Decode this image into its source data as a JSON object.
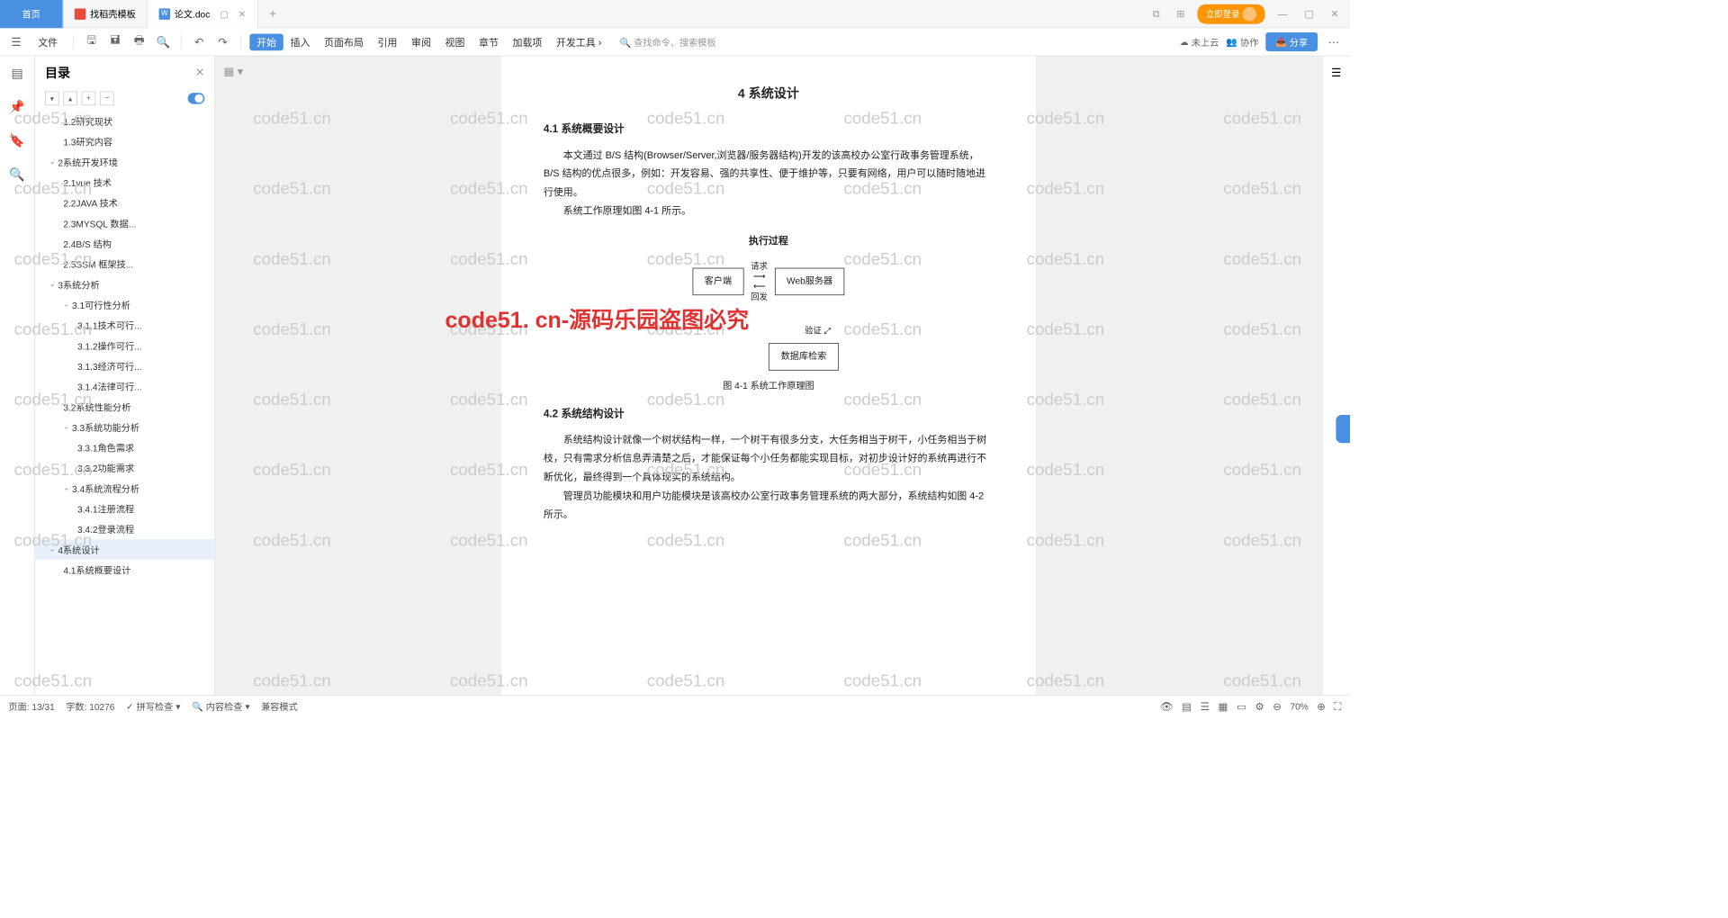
{
  "tabs": {
    "home": "首页",
    "template": "找稻壳模板",
    "doc": "论文.doc",
    "new": "+"
  },
  "titlebar": {
    "login": "立即登录"
  },
  "toolbar": {
    "file": "文件",
    "menu": [
      "开始",
      "插入",
      "页面布局",
      "引用",
      "审阅",
      "视图",
      "章节",
      "加载项",
      "开发工具"
    ],
    "search": "查找命令、搜索模板",
    "cloud": "未上云",
    "collab": "协作",
    "share": "分享"
  },
  "outline": {
    "title": "目录",
    "items": [
      {
        "l": 2,
        "t": "1.2研究现状"
      },
      {
        "l": 2,
        "t": "1.3研究内容"
      },
      {
        "l": 1,
        "t": "2系统开发环境",
        "c": true
      },
      {
        "l": 2,
        "t": "2.1vue 技术"
      },
      {
        "l": 2,
        "t": "2.2JAVA 技术"
      },
      {
        "l": 2,
        "t": "2.3MYSQL 数据..."
      },
      {
        "l": 2,
        "t": "2.4B/S 结构"
      },
      {
        "l": 2,
        "t": "2.5SSM 框架技..."
      },
      {
        "l": 1,
        "t": "3系统分析",
        "c": true
      },
      {
        "l": 2,
        "t": "3.1可行性分析",
        "c": true
      },
      {
        "l": 3,
        "t": "3.1.1技术可行..."
      },
      {
        "l": 3,
        "t": "3.1.2操作可行..."
      },
      {
        "l": 3,
        "t": "3.1.3经济可行..."
      },
      {
        "l": 3,
        "t": "3.1.4法律可行..."
      },
      {
        "l": 2,
        "t": "3.2系统性能分析"
      },
      {
        "l": 2,
        "t": "3.3系统功能分析",
        "c": true
      },
      {
        "l": 3,
        "t": "3.3.1角色需求"
      },
      {
        "l": 3,
        "t": "3.3.2功能需求"
      },
      {
        "l": 2,
        "t": "3.4系统流程分析",
        "c": true
      },
      {
        "l": 3,
        "t": "3.4.1注册流程"
      },
      {
        "l": 3,
        "t": "3.4.2登录流程"
      },
      {
        "l": 1,
        "t": "4系统设计",
        "c": true,
        "sel": true
      },
      {
        "l": 2,
        "t": "4.1系统概要设计"
      }
    ]
  },
  "doc": {
    "h1": "4  系统设计",
    "s41": "4.1  系统概要设计",
    "p1": "本文通过 B/S 结构(Browser/Server,浏览器/服务器结构)开发的该高校办公室行政事务管理系统，B/S 结构的优点很多，例如：开发容易、强的共享性、便于维护等，只要有网络，用户可以随时随地进行使用。",
    "p2": "系统工作原理如图 4-1 所示。",
    "dgtitle": "执行过程",
    "box1": "客户端",
    "box2": "Web服务器",
    "box3": "数据库检索",
    "arr1": "请求",
    "arr2": "回发",
    "arr3": "验证",
    "caption": "图 4-1  系统工作原理图",
    "s42": "4.2  系统结构设计",
    "p3": "系统结构设计就像一个树状结构一样，一个树干有很多分支，大任务相当于树干，小任务相当于树枝，只有需求分析信息弄清楚之后，才能保证每个小任务都能实现目标，对初步设计好的系统再进行不断优化，最终得到一个具体现实的系统结构。",
    "p4": "管理员功能模块和用户功能模块是该高校办公室行政事务管理系统的两大部分，系统结构如图 4-2 所示。"
  },
  "watermark": "code51. cn-源码乐园盗图必究",
  "wm_gray": "code51.cn",
  "status": {
    "page": "页面: 13/31",
    "words": "字数: 10276",
    "spell": "拼写检查",
    "content": "内容检查",
    "compat": "兼容模式",
    "zoom": "70%"
  }
}
